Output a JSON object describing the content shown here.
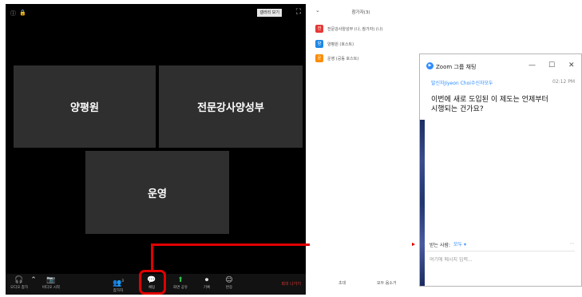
{
  "meeting": {
    "view_button": "갤러리 보기",
    "tiles": [
      "양평원",
      "전문강사양성부",
      "운영"
    ],
    "toolbar": [
      {
        "icon": "headphones-icon",
        "glyph": "🎧",
        "label": "오디오 참가"
      },
      {
        "icon": "video-off-icon",
        "glyph": "📷",
        "label": "비디오 시작"
      },
      {
        "icon": "participants-icon",
        "glyph": "👥",
        "label": "참가자",
        "count": "3"
      },
      {
        "icon": "chat-icon",
        "glyph": "💬",
        "label": "채팅"
      },
      {
        "icon": "share-screen-icon",
        "glyph": "⬆",
        "label": "화면 공유"
      },
      {
        "icon": "record-icon",
        "glyph": "⏺",
        "label": "기록"
      },
      {
        "icon": "reactions-icon",
        "glyph": "☺",
        "label": "반응"
      }
    ],
    "end_label": "회의 나가기",
    "accent_color": "#e10000",
    "share_color": "#2fc24f"
  },
  "participants": {
    "title": "참가자(3)",
    "items": [
      {
        "initial": "전",
        "name": "전문강사양성부 (나, 참가자) (나)",
        "color": "#e53935"
      },
      {
        "initial": "양",
        "name": "양평원 (호스트)",
        "color": "#1e88e5"
      },
      {
        "initial": "운",
        "name": "운영 (공동 호스트)",
        "color": "#fb8c00"
      }
    ],
    "invite_label": "초대",
    "mute_all_label": "모두 음소거"
  },
  "chat": {
    "title": "Zoom 그룹 채팅",
    "sender": "발신자Jiyeon Choi수신자모두",
    "time": "02:12 PM",
    "message": "이번에 새로 도입된 이 제도는 언제부터\n시행되는 건가요?",
    "recipient_label": "받는 사람:",
    "recipient_value": "모두 ▾",
    "input_placeholder": "여기에 메시지 입력..."
  }
}
